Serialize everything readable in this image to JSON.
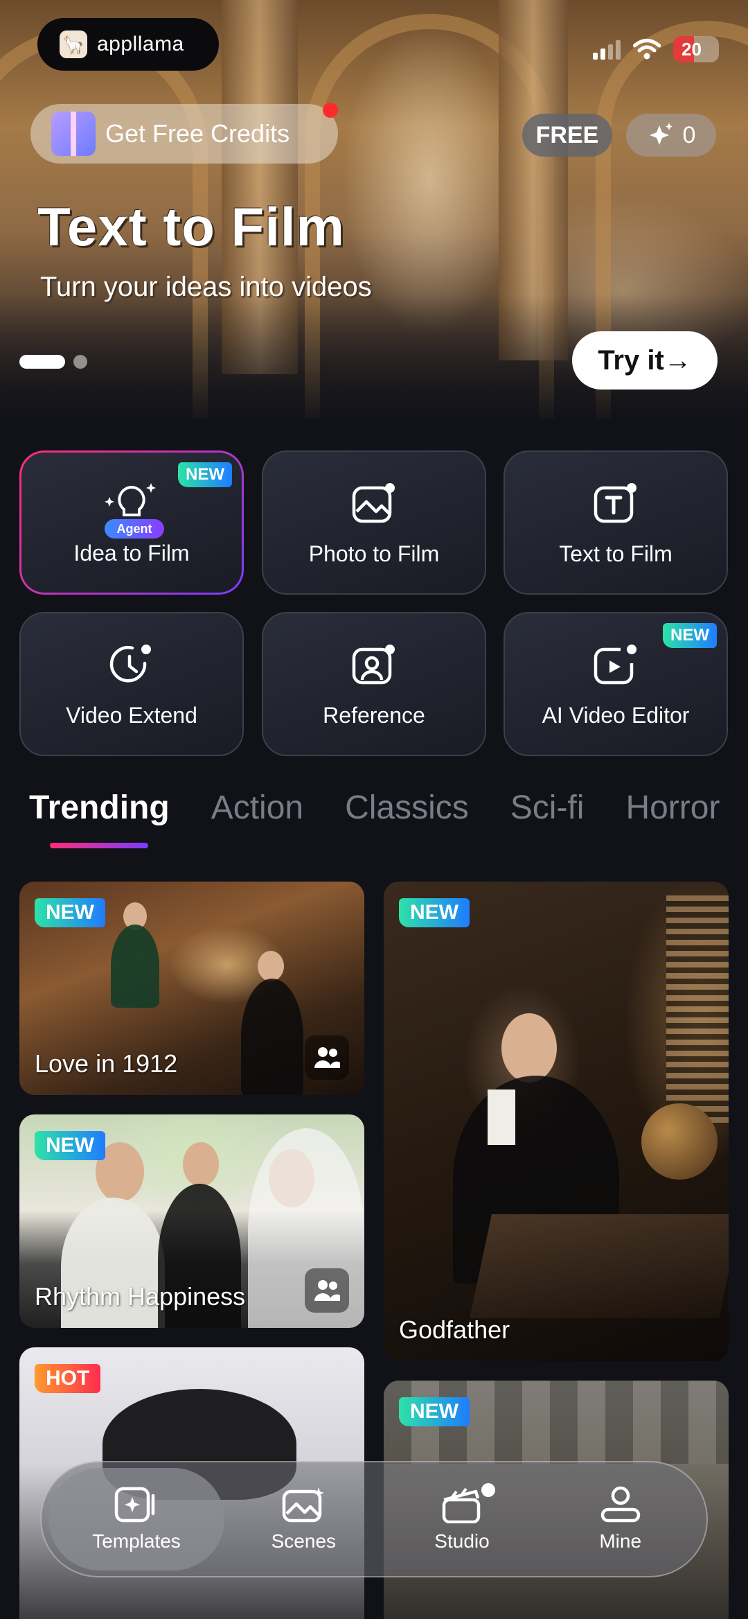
{
  "header": {
    "brand": "appllama",
    "battery": "20",
    "credits_label": "Get Free Credits",
    "free_badge": "FREE",
    "spark_count": "0"
  },
  "hero": {
    "title": "Text to Film",
    "subtitle": "Turn your ideas into videos",
    "cta": "Try it→",
    "slide_index": 1,
    "slide_count": 2
  },
  "features": [
    {
      "label": "Idea to Film",
      "icon": "lightbulb-icon",
      "badge": "NEW",
      "agent": "Agent"
    },
    {
      "label": "Photo to Film",
      "icon": "photo-icon"
    },
    {
      "label": "Text to Film",
      "icon": "text-icon"
    },
    {
      "label": "Video Extend",
      "icon": "clock-icon"
    },
    {
      "label": "Reference",
      "icon": "person-icon"
    },
    {
      "label": "AI Video Editor",
      "icon": "play-edit-icon",
      "badge": "NEW"
    }
  ],
  "tabs": [
    "Trending",
    "Action",
    "Classics",
    "Sci-fi",
    "Horror"
  ],
  "active_tab": "Trending",
  "cards": [
    {
      "title": "Love in 1912",
      "tag": "NEW"
    },
    {
      "title": "Rhythm Happiness",
      "tag": "NEW"
    },
    {
      "title": "Godfather",
      "tag": "NEW"
    },
    {
      "title": "",
      "tag": "HOT"
    },
    {
      "title": "",
      "tag": "NEW"
    }
  ],
  "nav": [
    {
      "label": "Templates",
      "icon": "templates-icon",
      "active": true
    },
    {
      "label": "Scenes",
      "icon": "scenes-icon"
    },
    {
      "label": "Studio",
      "icon": "studio-icon"
    },
    {
      "label": "Mine",
      "icon": "user-icon"
    }
  ],
  "colors": {
    "accent_gradient_start": "#ff2d78",
    "accent_gradient_end": "#7a3cff",
    "new_tag_start": "#2de2a8",
    "new_tag_end": "#1f7cff",
    "hot_tag_start": "#ff9a2d",
    "hot_tag_end": "#ff2d4f",
    "background": "#111218"
  }
}
